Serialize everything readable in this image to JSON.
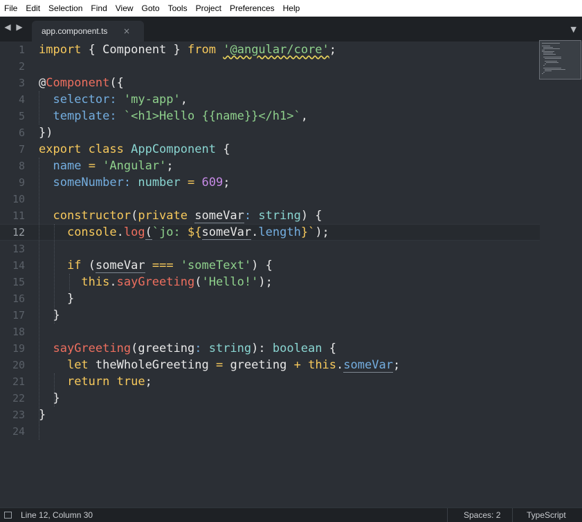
{
  "menubar": {
    "items": [
      "File",
      "Edit",
      "Selection",
      "Find",
      "View",
      "Goto",
      "Tools",
      "Project",
      "Preferences",
      "Help"
    ]
  },
  "tabbar": {
    "tab": {
      "title": "app.component.ts",
      "close": "×"
    },
    "nav_back": "◀",
    "nav_forward": "▶",
    "dropdown": "▼"
  },
  "editor": {
    "line_numbers": [
      "1",
      "2",
      "3",
      "4",
      "5",
      "6",
      "7",
      "8",
      "9",
      "10",
      "11",
      "12",
      "13",
      "14",
      "15",
      "16",
      "17",
      "18",
      "19",
      "20",
      "21",
      "22",
      "23",
      "24"
    ],
    "active_line": 12,
    "code": {
      "l1": [
        "import",
        "{",
        "Component",
        "}",
        "from",
        "'@angular/core'",
        ";"
      ],
      "l3": [
        "@",
        "Component",
        "({"
      ],
      "l4": [
        "selector",
        ":",
        "'my-app'",
        ","
      ],
      "l5": [
        "template",
        ":",
        "`<h1>Hello {{name}}</h1>`",
        ","
      ],
      "l6": [
        "})"
      ],
      "l7": [
        "export",
        "class",
        "AppComponent",
        "{"
      ],
      "l8": [
        "name",
        "=",
        "'Angular'",
        ";"
      ],
      "l9": [
        "someNumber",
        ":",
        "number",
        "=",
        "609",
        ";"
      ],
      "l11": [
        "constructor",
        "(",
        "private",
        "someVar",
        ":",
        "string",
        ") {"
      ],
      "l12": [
        "console",
        ".",
        "log",
        "(",
        "`jo: ",
        "${",
        "someVar",
        ".",
        "length",
        "}`",
        ");"
      ],
      "l14": [
        "if",
        "(",
        "someVar",
        "===",
        "'someText'",
        ") {"
      ],
      "l15": [
        "this",
        ".",
        "sayGreeting",
        "(",
        "'Hello!'",
        ");"
      ],
      "l16": [
        "}"
      ],
      "l17": [
        "}"
      ],
      "l19": [
        "sayGreeting",
        "(",
        "greeting",
        ":",
        "string",
        "): ",
        "boolean",
        "{"
      ],
      "l20": [
        "let",
        "theWholeGreeting",
        "=",
        "greeting",
        "+",
        "this",
        ".",
        "someVar",
        ";"
      ],
      "l21": [
        "return",
        "true",
        ";"
      ],
      "l22": [
        "}"
      ],
      "l23": [
        "}"
      ]
    }
  },
  "statusbar": {
    "position": "Line 12, Column 30",
    "indent": "Spaces: 2",
    "syntax": "TypeScript"
  },
  "colors": {
    "background": "#2b2f35",
    "keyword": "#f7c95c",
    "string": "#8fd18c",
    "property": "#74aee0",
    "function": "#ee6f5f",
    "type": "#8ad6d2",
    "number": "#c68ae6"
  },
  "icons": {
    "status": "panel-icon",
    "nav": "arrow-icons",
    "dropdown": "chevron-down-icon"
  }
}
